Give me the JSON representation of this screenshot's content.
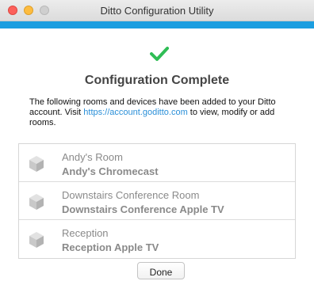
{
  "window": {
    "title": "Ditto Configuration Utility",
    "accent_color": "#1b9ee0"
  },
  "status": {
    "icon": "checkmark-icon",
    "icon_color": "#2fbd55",
    "heading": "Configuration Complete",
    "description_prefix": "The following rooms and devices have been added to your Ditto account. Visit ",
    "link_text": "https://account.goditto.com",
    "description_suffix": " to view, modify or add rooms."
  },
  "rooms": [
    {
      "room": "Andy's Room",
      "device": "Andy's Chromecast",
      "icon": "cube-icon"
    },
    {
      "room": "Downstairs Conference Room",
      "device": "Downstairs Conference Apple TV",
      "icon": "cube-icon"
    },
    {
      "room": "Reception",
      "device": "Reception Apple TV",
      "icon": "cube-icon"
    }
  ],
  "actions": {
    "done_label": "Done"
  }
}
